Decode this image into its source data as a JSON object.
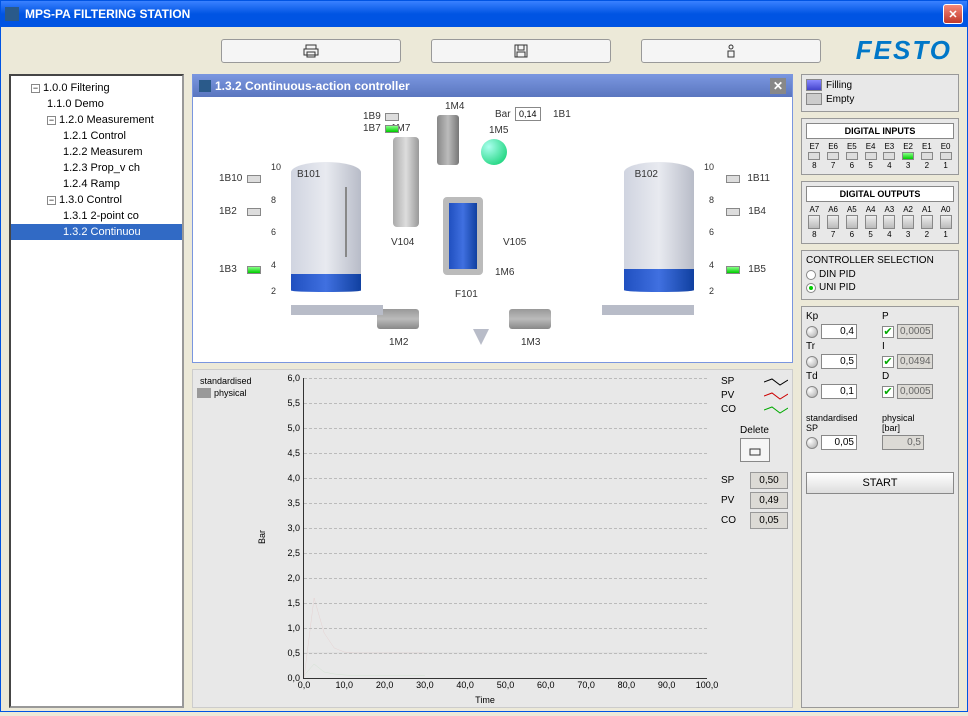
{
  "window": {
    "title": "MPS-PA FILTERING STATION"
  },
  "logo": "FESTO",
  "tree": {
    "items": [
      {
        "label": "1.0.0 Filtering",
        "indent": 1,
        "expand": "−"
      },
      {
        "label": "1.1.0 Demo",
        "indent": 2
      },
      {
        "label": "1.2.0 Measurement",
        "indent": 2,
        "expand": "−"
      },
      {
        "label": "1.2.1 Control",
        "indent": 3
      },
      {
        "label": "1.2.2 Measurem",
        "indent": 3
      },
      {
        "label": "1.2.3 Prop_v ch",
        "indent": 3
      },
      {
        "label": "1.2.4 Ramp",
        "indent": 3
      },
      {
        "label": "1.3.0 Control",
        "indent": 2,
        "expand": "−"
      },
      {
        "label": "1.3.1 2-point co",
        "indent": 3
      },
      {
        "label": "1.3.2 Continuou",
        "indent": 3,
        "selected": true
      }
    ]
  },
  "diagram": {
    "title": "1.3.2 Continuous-action controller",
    "labels": {
      "b101": "B101",
      "b102": "B102",
      "m7": "1M7",
      "m4": "1M4",
      "m5": "1M5",
      "m6": "1M6",
      "m2": "1M2",
      "m3": "1M3",
      "b9": "1B9",
      "b7": "1B7",
      "b1": "1B1",
      "b10": "1B10",
      "b11": "1B11",
      "b2": "1B2",
      "b4": "1B4",
      "b3": "1B3",
      "b5": "1B5",
      "v104": "V104",
      "v105": "V105",
      "f101": "F101",
      "bar": "Bar",
      "bar_val": "0,14"
    },
    "scale": [
      "10",
      "8",
      "6",
      "4",
      "2"
    ]
  },
  "chart_data": {
    "type": "line",
    "x": [
      0,
      5,
      10,
      15,
      20,
      25,
      30,
      35,
      40,
      45,
      50,
      55,
      60,
      65,
      70,
      75,
      80,
      85,
      90,
      95,
      100
    ],
    "xlabel": "Time",
    "ylabel": "Bar",
    "ylim": [
      0,
      6
    ],
    "xlim": [
      0,
      100
    ],
    "yticks": [
      "0,0",
      "0,5",
      "1,0",
      "1,5",
      "2,0",
      "2,5",
      "3,0",
      "3,5",
      "4,0",
      "4,5",
      "5,0",
      "5,5",
      "6,0"
    ],
    "xticks": [
      "0,0",
      "10,0",
      "20,0",
      "30,0",
      "40,0",
      "50,0",
      "60,0",
      "70,0",
      "80,0",
      "90,0",
      "100,0"
    ],
    "series": [
      {
        "name": "SP",
        "color": "#000",
        "values": [
          0.5,
          0.5,
          0.5,
          0.5,
          0.5,
          0.5,
          0.5,
          0.5,
          0.5,
          0.5,
          0.5,
          0.5,
          0.5,
          0.5,
          0.5,
          0.5,
          0.5,
          0.5,
          0.5,
          0.5,
          0.5
        ]
      },
      {
        "name": "PV",
        "color": "#c00",
        "values_visible_to": 30,
        "values": [
          0.0,
          1.6,
          0.9,
          0.6,
          0.52,
          0.5,
          0.5,
          0.5,
          0.5,
          0.5,
          0.5,
          0.5,
          0.5
        ]
      },
      {
        "name": "CO",
        "color": "#0a0",
        "values_visible_to": 30,
        "values": [
          0.05,
          0.28,
          0.12,
          0.08,
          0.06,
          0.05,
          0.05,
          0.05,
          0.05,
          0.05,
          0.05,
          0.05,
          0.05
        ]
      }
    ]
  },
  "chart": {
    "tabs": {
      "std": "standardised",
      "phys": "physical"
    },
    "legend": {
      "sp": "SP",
      "pv": "PV",
      "co": "CO"
    },
    "delete": "Delete",
    "vals": {
      "sp": "0,50",
      "pv": "0,49",
      "co": "0,05"
    }
  },
  "right": {
    "fill": {
      "filling": "Filling",
      "empty": "Empty"
    },
    "din_title": "DIGITAL INPUTS",
    "din_cols": [
      "E7",
      "E6",
      "E5",
      "E4",
      "E3",
      "E2",
      "E1",
      "E0"
    ],
    "din_states": [
      false,
      false,
      false,
      false,
      false,
      true,
      false,
      false
    ],
    "din_nums": [
      "8",
      "7",
      "6",
      "5",
      "4",
      "3",
      "2",
      "1"
    ],
    "dout_title": "DIGITAL OUTPUTS",
    "dout_cols": [
      "A7",
      "A6",
      "A5",
      "A4",
      "A3",
      "A2",
      "A1",
      "A0"
    ],
    "dout_nums": [
      "8",
      "7",
      "6",
      "5",
      "4",
      "3",
      "2",
      "1"
    ],
    "ctrl_title": "CONTROLLER SELECTION",
    "radios": {
      "din": "DIN PID",
      "uni": "UNI PID"
    },
    "params": {
      "kp_l": "Kp",
      "kp": "0,4",
      "p_l": "P",
      "p": "0,0005",
      "tr_l": "Tr",
      "tr": "0,5",
      "i_l": "I",
      "i": "0,0494",
      "td_l": "Td",
      "td": "0,1",
      "d_l": "D",
      "d": "0,0005",
      "std_l": "standardised",
      "phys_l": "physical",
      "sp_l": "SP",
      "sp": "0,05",
      "bar_l": "[bar]",
      "bar": "0,5"
    },
    "start": "START"
  }
}
